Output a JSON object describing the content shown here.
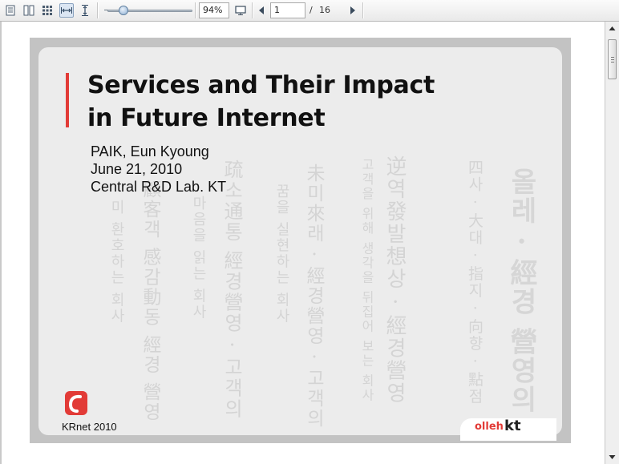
{
  "toolbar": {
    "zoom_value": "94%",
    "page_input_value": "1",
    "page_separator": "/",
    "page_total": "16",
    "zoom_level_fraction": 0.15
  },
  "slide": {
    "title_line1": "Services and Their Impact",
    "title_line2": "in Future Internet",
    "author": "PAIK, Eun Kyoung",
    "date": "June 21, 2010",
    "affiliation": "Central R&D Lab. KT",
    "footer": "KRnet 2010",
    "brand_olleh": "olleh",
    "brand_kt": "kt",
    "background_columns": [
      "올레 · 經경 營영의",
      "四사 · 大대 · 指지 · 向향 · 點점",
      "逆역發발想상 · 經경營영",
      "고객을 위해 생각을 뒤집어 보는 회사",
      "未미來래 · 經경營영 · 고객의",
      "꿈을 실현하는 회사",
      "疏소通통 經경營영 · 고객의",
      "마음을 읽는 회사",
      "顧客객 感감動동 經경 營영",
      "미 환호하는 회사"
    ]
  },
  "colors": {
    "accent": "#e23b37",
    "slide_border": "#c3c3c3",
    "slide_panel": "#ececec"
  }
}
